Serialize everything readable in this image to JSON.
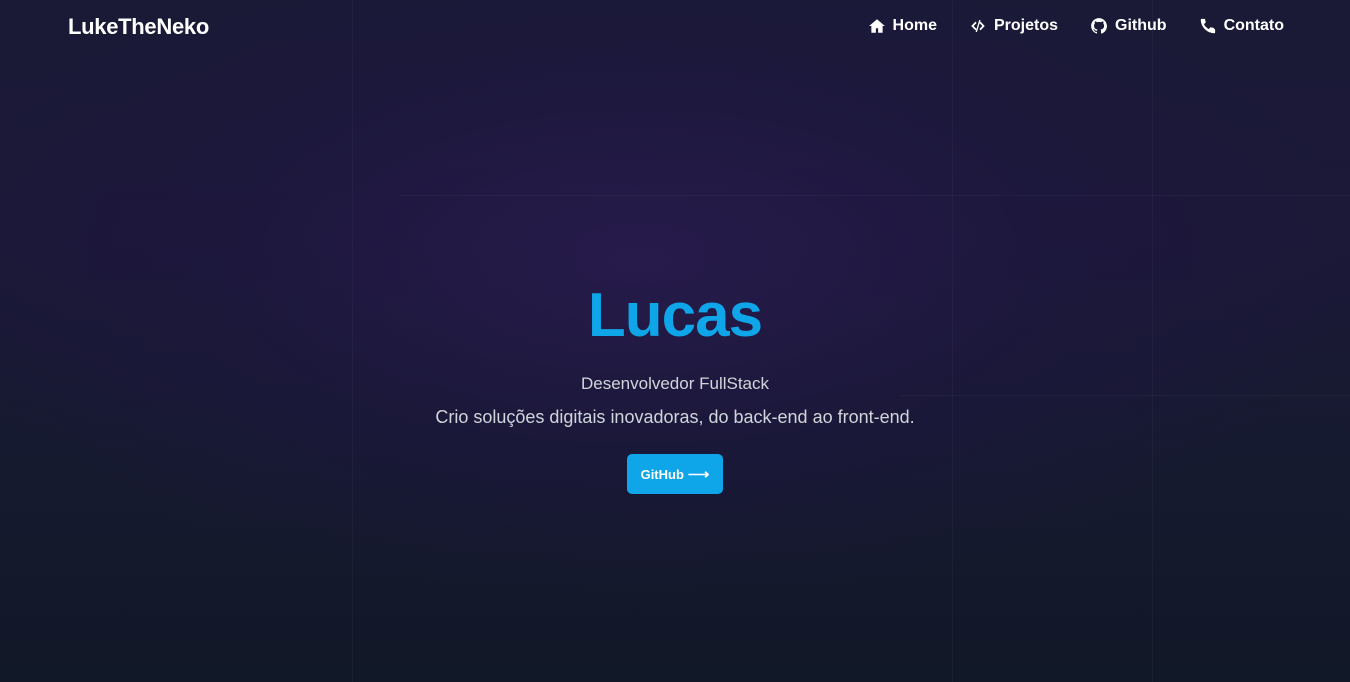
{
  "navbar": {
    "brand": "LukeTheNeko",
    "links": [
      {
        "label": "Home",
        "icon": "home-icon"
      },
      {
        "label": "Projetos",
        "icon": "code-icon"
      },
      {
        "label": "Github",
        "icon": "github-icon"
      },
      {
        "label": "Contato",
        "icon": "phone-icon"
      }
    ]
  },
  "hero": {
    "title": "Lucas",
    "subtitle": "Desenvolvedor FullStack",
    "description": "Crio soluções digitais inovadoras, do back-end ao front-end.",
    "button_label": "GitHub",
    "button_icon": "arrow-right-icon"
  },
  "colors": {
    "accent": "#0ea5e9",
    "background": "#111827",
    "text_muted": "#d1d5db",
    "text_primary": "#ffffff"
  }
}
